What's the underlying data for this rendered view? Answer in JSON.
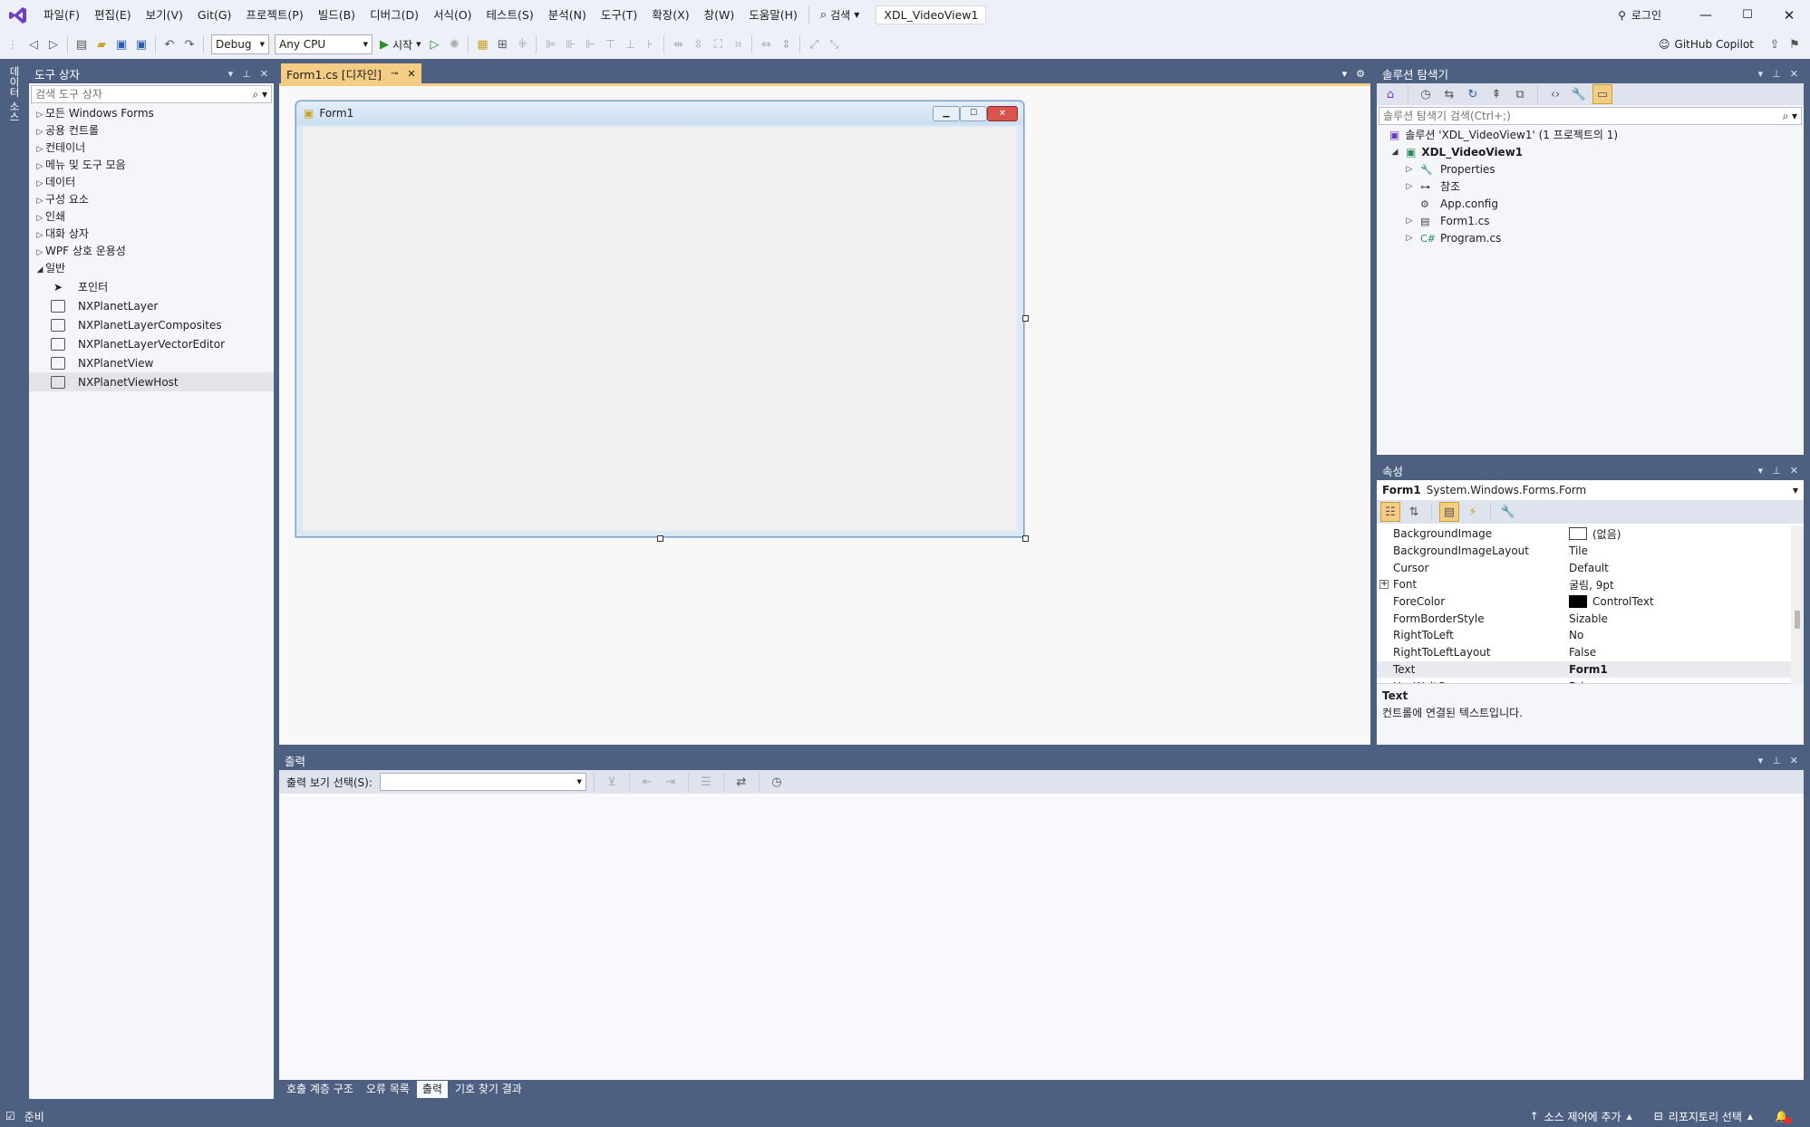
{
  "menu": [
    "파일(F)",
    "편집(E)",
    "보기(V)",
    "Git(G)",
    "프로젝트(P)",
    "빌드(B)",
    "디버그(D)",
    "서식(O)",
    "테스트(S)",
    "분석(N)",
    "도구(T)",
    "확장(X)",
    "창(W)",
    "도움말(H)"
  ],
  "search_label": "검색",
  "solution_name": "XDL_VideoView1",
  "login_label": "로그인",
  "copilot_label": "GitHub Copilot",
  "config_value": "Debug",
  "platform_value": "Any CPU",
  "start_label": "시작",
  "side_tabs": [
    "데이터 소스"
  ],
  "toolbox": {
    "title": "도구 상자",
    "search_placeholder": "검색 도구 상자",
    "groups": [
      "모든 Windows Forms",
      "공용 컨트롤",
      "컨테이너",
      "메뉴 및 도구 모음",
      "데이터",
      "구성 요소",
      "인쇄",
      "대화 상자",
      "WPF 상호 운용성"
    ],
    "open_group": "일반",
    "items": [
      "포인터",
      "NXPlanetLayer",
      "NXPlanetLayerComposites",
      "NXPlanetLayerVectorEditor",
      "NXPlanetView",
      "NXPlanetViewHost"
    ]
  },
  "doc_tab": "Form1.cs [디자인]",
  "form_title": "Form1",
  "solution_explorer": {
    "title": "솔루션 탐색기",
    "search_placeholder": "솔루션 탐색기 검색(Ctrl+;)",
    "solution_line": "솔루션 'XDL_VideoView1' (1 프로젝트의 1)",
    "project": "XDL_VideoView1",
    "nodes": [
      "Properties",
      "참조",
      "App.config",
      "Form1.cs",
      "Program.cs"
    ]
  },
  "properties": {
    "title": "속성",
    "object_name": "Form1",
    "object_type": "System.Windows.Forms.Form",
    "rows": [
      {
        "name": "BackgroundImage",
        "value": "(없음)"
      },
      {
        "name": "BackgroundImageLayout",
        "value": "Tile"
      },
      {
        "name": "Cursor",
        "value": "Default"
      },
      {
        "name": "Font",
        "value": "굴림, 9pt"
      },
      {
        "name": "ForeColor",
        "value": "ControlText"
      },
      {
        "name": "FormBorderStyle",
        "value": "Sizable"
      },
      {
        "name": "RightToLeft",
        "value": "No"
      },
      {
        "name": "RightToLeftLayout",
        "value": "False"
      },
      {
        "name": "Text",
        "value": "Form1"
      },
      {
        "name": "UseWaitCursor",
        "value": "False"
      }
    ],
    "desc_title": "Text",
    "desc_text": "컨트롤에 연결된 텍스트입니다."
  },
  "output": {
    "title": "출력",
    "source_label": "출력 보기 선택(S):",
    "source_value": ""
  },
  "bottom_tabs": [
    "호출 계층 구조",
    "오류 목록",
    "출력",
    "기호 찾기 결과"
  ],
  "status": {
    "ready": "준비",
    "source_control": "소스 제어에 추가",
    "repo": "리포지토리 선택"
  },
  "colors": {
    "accent": "#4d6082",
    "vs_purple": "#6c3fc7",
    "tab_active": "#f5cc84",
    "form_close": "#d9534f"
  }
}
